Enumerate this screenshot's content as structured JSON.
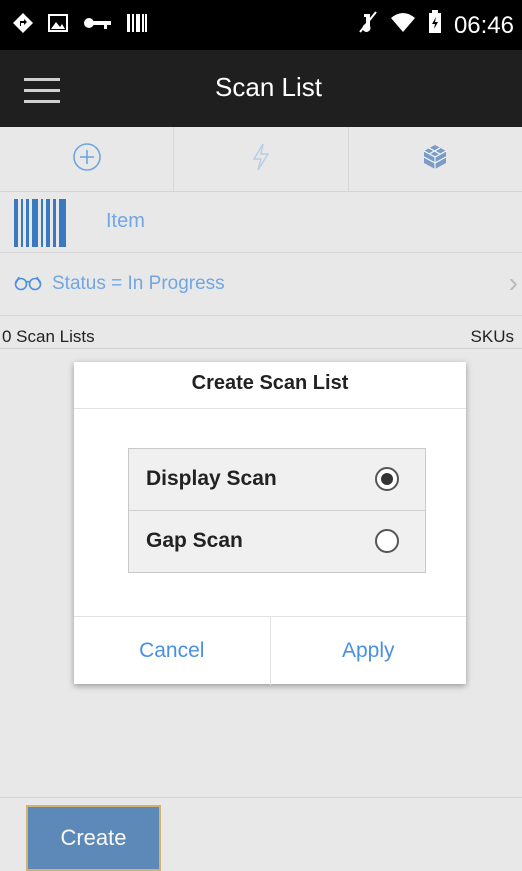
{
  "status_bar": {
    "time": "06:46",
    "icons": [
      "navigation-diamond-icon",
      "image-icon",
      "key-icon",
      "barcode-icon",
      "mute-icon",
      "wifi-icon",
      "battery-icon"
    ]
  },
  "header": {
    "title": "Scan List"
  },
  "toolbar": {
    "icons": [
      "add-circle-icon",
      "lightning-icon",
      "cube-icon"
    ]
  },
  "search": {
    "item_label": "Item"
  },
  "filter": {
    "status_label": "Status = In Progress",
    "chevron": "›"
  },
  "summary": {
    "count_label": "0 Scan Lists",
    "skus_label": "SKUs"
  },
  "dialog": {
    "title": "Create Scan List",
    "options": [
      {
        "label": "Display Scan",
        "selected": true
      },
      {
        "label": "Gap Scan",
        "selected": false
      }
    ],
    "cancel_label": "Cancel",
    "apply_label": "Apply"
  },
  "footer": {
    "create_label": "Create"
  },
  "colors": {
    "accent": "#4a90e2",
    "primary_button": "#2f6aa8",
    "header_bg": "#1f1f1f"
  }
}
